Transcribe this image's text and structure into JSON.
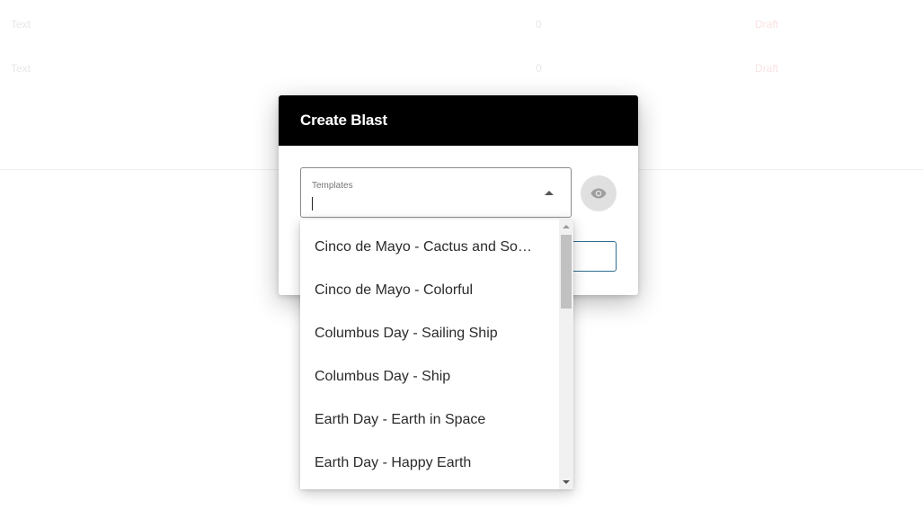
{
  "background": {
    "rows": [
      {
        "type": "Text",
        "count": "0",
        "status": "Draft"
      },
      {
        "type": "Text",
        "count": "0",
        "status": "Draft"
      }
    ]
  },
  "dialog": {
    "title": "Create Blast",
    "templates_label": "Templates",
    "templates_value": "",
    "preview_icon": "eye-icon",
    "dropdown_icon": "arrow-up-icon"
  },
  "dropdown": {
    "options": [
      "Cinco de Mayo - Cactus and Sombrero",
      "Cinco de Mayo - Colorful",
      "Columbus Day - Sailing Ship",
      "Columbus Day - Ship",
      "Earth Day - Earth in Space",
      "Earth Day - Happy Earth"
    ]
  },
  "colors": {
    "header_bg": "#000000",
    "header_text": "#ffffff",
    "preview_button_bg": "#e0e0e0",
    "accent_border": "#2f6f8f"
  }
}
